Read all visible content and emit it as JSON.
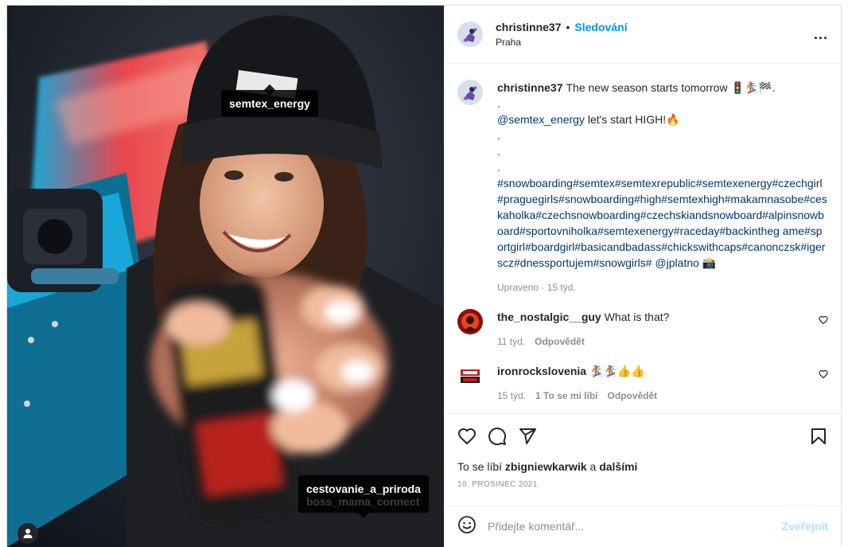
{
  "photo": {
    "tags": [
      "semtex_energy",
      "cestovanie_a_priroda",
      "boss_mama_connect"
    ],
    "user_badge_icon": "user-icon"
  },
  "header": {
    "username": "christinne37",
    "separator": "•",
    "follow_label": "Sledování",
    "location": "Praha",
    "more_label": "..."
  },
  "caption": {
    "username": "christinne37",
    "line1": "The new season starts tomorrow 🚦🏂🏁.",
    "dot1": ".",
    "mention": "@semtex_energy",
    "line2": " let's start HIGH!🔥",
    "dot2": ".",
    "dot3": ".",
    "dot4": ".",
    "hashtags": "#snowboarding#semtex#semtexrepublic#semtexenergy#czechgirl#praguegirls#snowboarding#high#semtexhigh#makamnasobe#ceskaholka#czechsnowboarding#czechskiandsnowboard#alpinsnowboard#sportovniholka#semtexenergy#raceday#backintheg ame#sportgirl#boardgirl#basicandbadass#chickswithcaps#canonczsk#igerscz#dnessportujem#snowgirls#",
    "tail_mention": "@jplatno",
    "tail_emoji": "📸",
    "meta": "Upraveno · 15 týd."
  },
  "comments": [
    {
      "username": "the_nostalgic__guy",
      "text": "What is that?",
      "time": "11 týd.",
      "reply": "Odpovědět"
    },
    {
      "username": "ironrockslovenia",
      "text": "🏂🏂👍👍",
      "time": "15 týd.",
      "likes": "1 To se mi líbí",
      "reply": "Odpovědět"
    }
  ],
  "actions": {
    "likes_prefix": "To se líbí ",
    "likes_user": "zbigniewkarwik",
    "likes_mid": " a ",
    "likes_others": "dalšími",
    "date": "10. PROSINEC 2021"
  },
  "add_comment": {
    "placeholder": "Přidejte komentář...",
    "post_label": "Zveřejnit"
  },
  "colors": {
    "accent": "#0095f6",
    "link": "#00376b",
    "muted": "#8e8e8e"
  }
}
